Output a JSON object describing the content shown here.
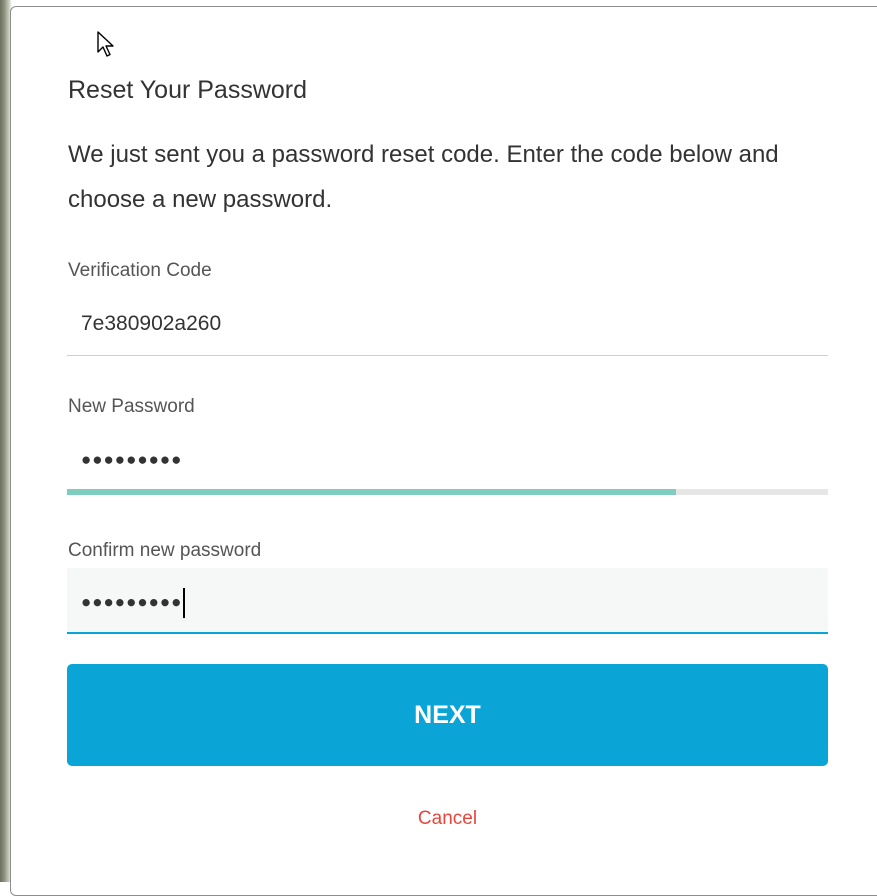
{
  "form": {
    "title": "Reset Your Password",
    "description": "We just sent you a password reset code. Enter the code below and choose a new password.",
    "verification_code": {
      "label": "Verification Code",
      "value": "7e380902a260"
    },
    "new_password": {
      "label": "New Password",
      "masked_value": "●●●●●●●●●",
      "strength_fraction": 0.8
    },
    "confirm_password": {
      "label": "Confirm new password",
      "masked_value": "●●●●●●●●●"
    },
    "next_label": "NEXT",
    "cancel_label": "Cancel"
  },
  "colors": {
    "accent": "#0aa4d6",
    "strength": "#7fcdbf",
    "cancel": "#e8453c",
    "focus_underline": "#0aa4d6"
  },
  "icons": {
    "cursor": "mouse-pointer-icon"
  }
}
